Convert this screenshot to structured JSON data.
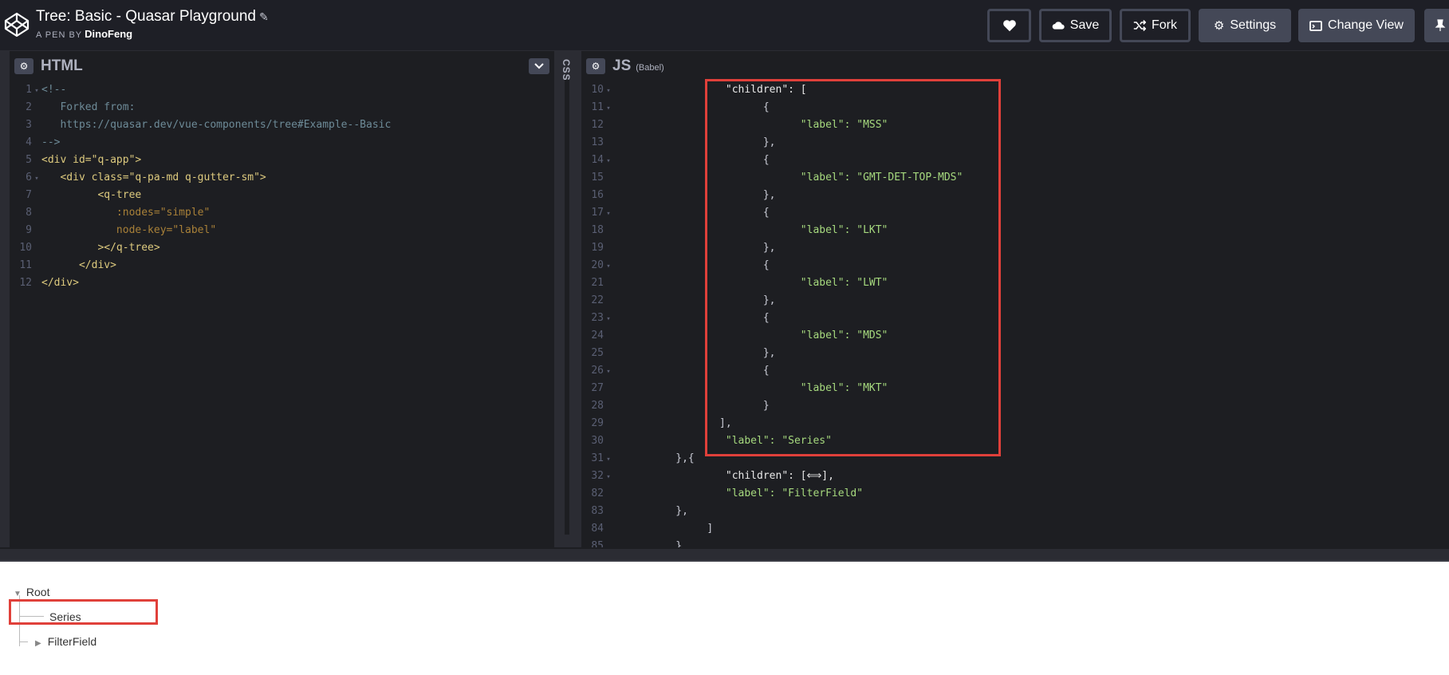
{
  "header": {
    "title": "Tree: Basic - Quasar Playground",
    "pen_by": "A PEN BY",
    "author": "DinoFeng",
    "buttons": {
      "save": "Save",
      "fork": "Fork",
      "settings": "Settings",
      "change_view": "Change View"
    }
  },
  "html_pane": {
    "title": "HTML",
    "lines": [
      {
        "n": "1",
        "fold": true,
        "text": "<!--",
        "cls": "c-com"
      },
      {
        "n": "2",
        "text": "   Forked from:",
        "cls": "c-com"
      },
      {
        "n": "3",
        "text": "   https://quasar.dev/vue-components/tree#Example--Basic",
        "cls": "c-com"
      },
      {
        "n": "4",
        "text": "-->",
        "cls": "c-com"
      },
      {
        "n": "5",
        "text": "<div id=\"q-app\">",
        "cls": "c-tag"
      },
      {
        "n": "6",
        "fold": true,
        "text": "   <div class=\"q-pa-md q-gutter-sm\">",
        "cls": "c-tag"
      },
      {
        "n": "7",
        "text": "         <q-tree",
        "cls": "c-tag"
      },
      {
        "n": "8",
        "text": "            :nodes=\"simple\"",
        "cls": "c-attr"
      },
      {
        "n": "9",
        "text": "            node-key=\"label\"",
        "cls": "c-attr"
      },
      {
        "n": "10",
        "text": "         ></q-tree>",
        "cls": "c-tag"
      },
      {
        "n": "11",
        "text": "      </div>",
        "cls": "c-tag"
      },
      {
        "n": "12",
        "text": "</div>",
        "cls": "c-tag"
      }
    ]
  },
  "css_pane": {
    "title": "CSS"
  },
  "js_pane": {
    "title": "JS",
    "subtitle": "(Babel)",
    "lines": [
      {
        "n": "10",
        "fold": true,
        "text": "                  \"children\": [",
        "cls": "c-key"
      },
      {
        "n": "11",
        "fold": true,
        "text": "                        {",
        "cls": "c-punc"
      },
      {
        "n": "12",
        "text": "                              \"label\": \"MSS\"",
        "cls": "c-str"
      },
      {
        "n": "13",
        "text": "                        },",
        "cls": "c-punc"
      },
      {
        "n": "14",
        "fold": true,
        "text": "                        {",
        "cls": "c-punc"
      },
      {
        "n": "15",
        "text": "                              \"label\": \"GMT-DET-TOP-MDS\"",
        "cls": "c-str"
      },
      {
        "n": "16",
        "text": "                        },",
        "cls": "c-punc"
      },
      {
        "n": "17",
        "fold": true,
        "text": "                        {",
        "cls": "c-punc"
      },
      {
        "n": "18",
        "text": "                              \"label\": \"LKT\"",
        "cls": "c-str"
      },
      {
        "n": "19",
        "text": "                        },",
        "cls": "c-punc"
      },
      {
        "n": "20",
        "fold": true,
        "text": "                        {",
        "cls": "c-punc"
      },
      {
        "n": "21",
        "text": "                              \"label\": \"LWT\"",
        "cls": "c-str"
      },
      {
        "n": "22",
        "text": "                        },",
        "cls": "c-punc"
      },
      {
        "n": "23",
        "fold": true,
        "text": "                        {",
        "cls": "c-punc"
      },
      {
        "n": "24",
        "text": "                              \"label\": \"MDS\"",
        "cls": "c-str"
      },
      {
        "n": "25",
        "text": "                        },",
        "cls": "c-punc"
      },
      {
        "n": "26",
        "fold": true,
        "text": "                        {",
        "cls": "c-punc"
      },
      {
        "n": "27",
        "text": "                              \"label\": \"MKT\"",
        "cls": "c-str"
      },
      {
        "n": "28",
        "text": "                        }",
        "cls": "c-punc"
      },
      {
        "n": "29",
        "text": "                 ],",
        "cls": "c-punc"
      },
      {
        "n": "30",
        "text": "                  \"label\": \"Series\"",
        "cls": "c-str"
      },
      {
        "n": "31",
        "fold": true,
        "text": "          },{",
        "cls": "c-punc"
      },
      {
        "n": "32",
        "fold": true,
        "text": "                  \"children\": [⟺],",
        "cls": "c-key"
      },
      {
        "n": "82",
        "text": "                  \"label\": \"FilterField\"",
        "cls": "c-str"
      },
      {
        "n": "83",
        "text": "          },",
        "cls": "c-punc"
      },
      {
        "n": "84",
        "text": "               ]",
        "cls": "c-punc"
      },
      {
        "n": "85",
        "text": "          }",
        "cls": "c-punc"
      }
    ]
  },
  "result_tree": {
    "root": "Root",
    "child1": "Series",
    "child2": "FilterField"
  },
  "colors": {
    "header_bg": "#1e1f26",
    "editor_bg": "#1d1e22",
    "highlight": "#e0403a"
  }
}
